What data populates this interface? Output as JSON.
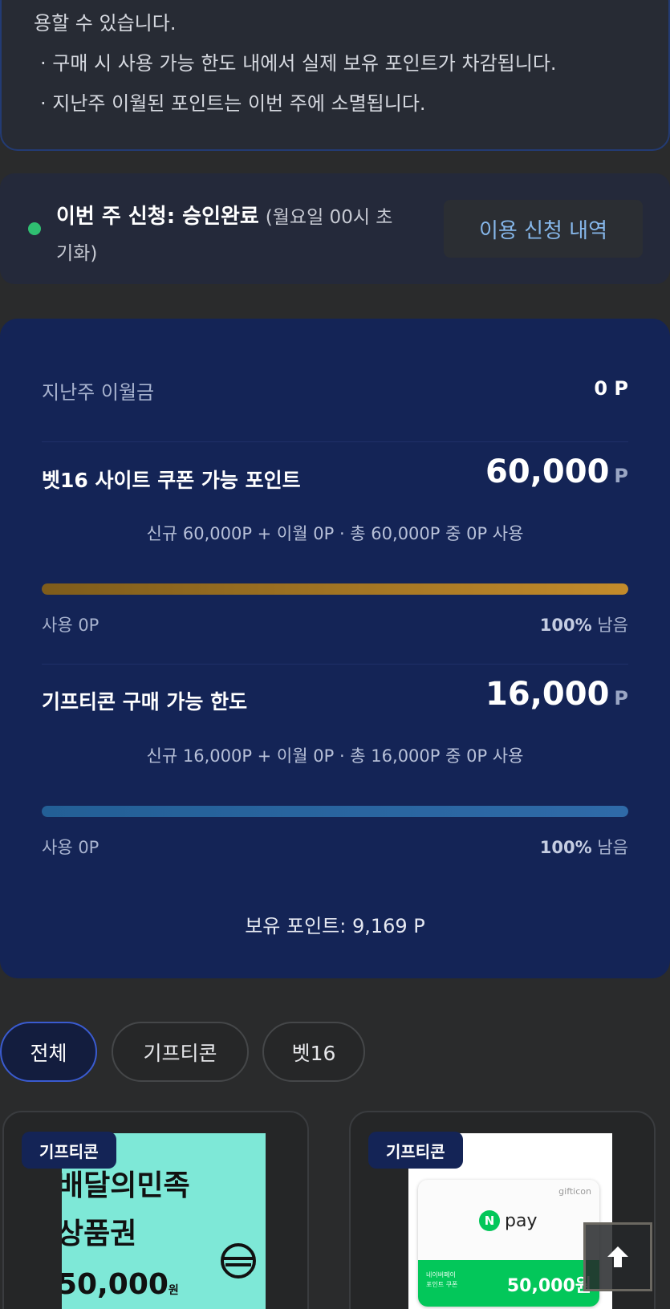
{
  "notice": {
    "line1": "용할 수 있습니다.",
    "line2": "· 구매 시 사용 가능 한도 내에서 실제 보유 포인트가 차감됩니다.",
    "line3": "· 지난주 이월된 포인트는 이번 주에 소멸됩니다."
  },
  "status": {
    "label": "이번 주 신청: 승인완료",
    "sub_a": "(월요일 00시 초",
    "sub_b": "기화)",
    "history_button": "이용 신청 내역",
    "dot_color": "#2fbf71"
  },
  "points": {
    "carryover_label": "지난주 이월금",
    "carryover_value": "0 P",
    "site": {
      "label": "벳16 사이트 쿠폰 가능 포인트",
      "value": "60,000",
      "unit": "P",
      "desc": "신규 60,000P + 이월 0P · 총 60,000P 중 0P 사용",
      "used": "사용 0P",
      "remain_pct": "100%",
      "remain_word": "남음",
      "remaining_fraction": 1.0
    },
    "gifticon": {
      "label": "기프티콘 구매 가능 한도",
      "value": "16,000",
      "unit": "P",
      "desc": "신규 16,000P + 이월 0P · 총 16,000P 중 0P 사용",
      "used": "사용 0P",
      "remain_pct": "100%",
      "remain_word": "남음",
      "remaining_fraction": 1.0
    },
    "owned": "보유 포인트: 9,169 P"
  },
  "filters": [
    {
      "label": "전체",
      "active": true
    },
    {
      "label": "기프티콘",
      "active": false
    },
    {
      "label": "벳16",
      "active": false
    }
  ],
  "products": [
    {
      "badge": "기프티콘",
      "image": {
        "line1": "배달의민족",
        "line2": "상품권",
        "amount": "50,000",
        "won": "원"
      }
    },
    {
      "badge": "기프티콘",
      "image": {
        "brand": "gifticon",
        "logo": "pay",
        "coupon_label_1": "네이버페이",
        "coupon_label_2": "포인트 쿠폰",
        "amount": "50,000원"
      }
    }
  ],
  "icons": {
    "scroll_top": "arrow-up-icon",
    "status": "status-dot-icon"
  }
}
